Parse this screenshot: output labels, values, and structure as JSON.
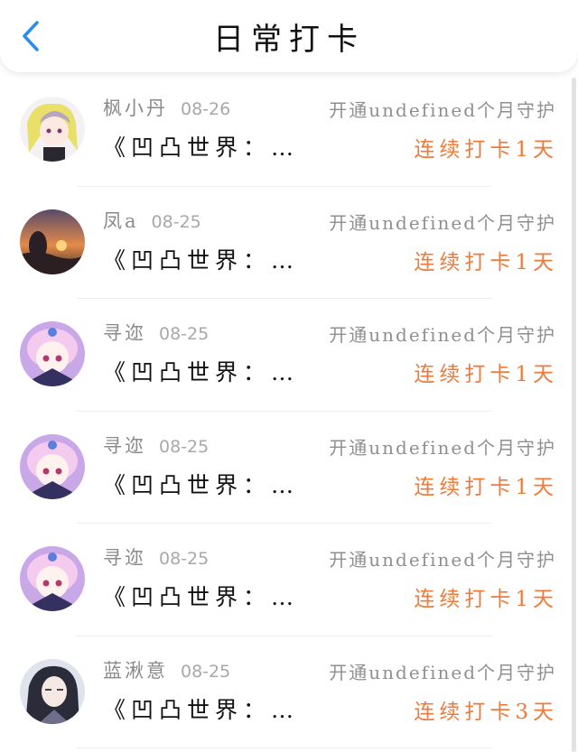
{
  "header": {
    "title": "日常打卡",
    "back_icon": "chevron-left-icon",
    "accent_color": "#2a8cf0"
  },
  "colors": {
    "streak": "#ef7a3a",
    "name": "#8a8a8a",
    "book": "#111111"
  },
  "checkins": [
    {
      "name": "枫小丹",
      "date": "08-26",
      "guard_text": "开通undefined个月守护",
      "book": "《凹凸世界：…",
      "streak": "连续打卡1天",
      "avatar_icon": "anime-avatar-icon"
    },
    {
      "name": "凤a",
      "date": "08-25",
      "guard_text": "开通undefined个月守护",
      "book": "《凹凸世界：…",
      "streak": "连续打卡1天",
      "avatar_icon": "sunset-avatar-icon"
    },
    {
      "name": "寻迩",
      "date": "08-25",
      "guard_text": "开通undefined个月守护",
      "book": "《凹凸世界：…",
      "streak": "连续打卡1天",
      "avatar_icon": "anime-avatar-icon"
    },
    {
      "name": "寻迩",
      "date": "08-25",
      "guard_text": "开通undefined个月守护",
      "book": "《凹凸世界：…",
      "streak": "连续打卡1天",
      "avatar_icon": "anime-avatar-icon"
    },
    {
      "name": "寻迩",
      "date": "08-25",
      "guard_text": "开通undefined个月守护",
      "book": "《凹凸世界：…",
      "streak": "连续打卡1天",
      "avatar_icon": "anime-avatar-icon"
    },
    {
      "name": "蓝湫意",
      "date": "08-25",
      "guard_text": "开通undefined个月守护",
      "book": "《凹凸世界：…",
      "streak": "连续打卡3天",
      "avatar_icon": "anime-avatar-icon"
    }
  ]
}
